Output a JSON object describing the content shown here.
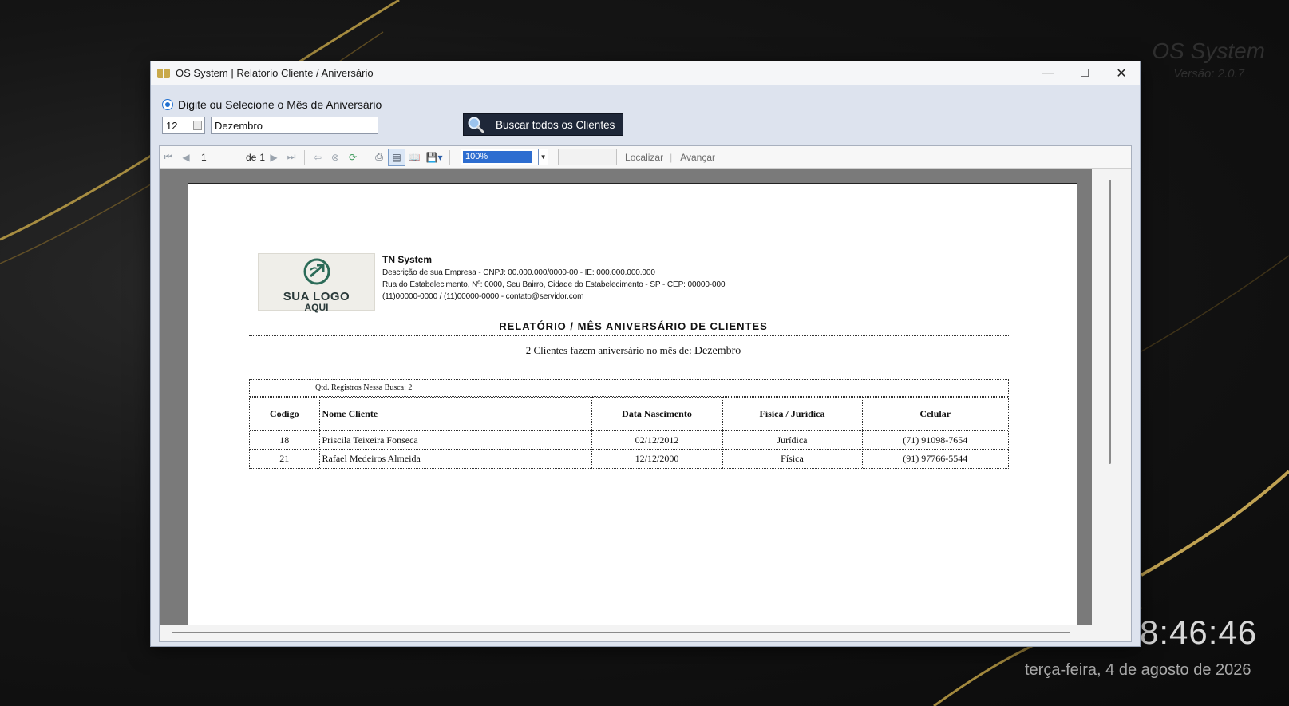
{
  "desktop": {
    "brand_name": "OS System",
    "brand_version": "Versão: 2.0.7",
    "clock_time": "8:46:46",
    "clock_date": "terça-feira, 4 de agosto de 2026"
  },
  "window": {
    "title": "OS System | Relatorio Cliente / Aniversário"
  },
  "filter": {
    "radio_label": "Digite ou Selecione o Mês de Aniversário",
    "month_number": "12",
    "month_name": "Dezembro",
    "search_all_label": "Buscar todos os Clientes"
  },
  "toolbar": {
    "current_page": "1",
    "page_of_label": "de",
    "total_pages": "1",
    "zoom": "100%",
    "find_label": "Localizar",
    "next_label": "Avançar"
  },
  "report": {
    "company_name": "TN System",
    "company_line1": "Descrição de sua Empresa  - CNPJ: 00.000.000/0000-00 -  IE: 000.000.000.000",
    "company_line2": "Rua do Estabelecimento,  Nº: 0000,  Seu Bairro,  Cidade do Estabelecimento -  SP  -  CEP: 00000-000",
    "company_line3": "(11)00000-0000 /  (11)00000-0000 -  contato@servidor.com",
    "logo_line1": "SUA LOGO",
    "logo_line2": "AQUI",
    "title": "RELATÓRIO / MÊS ANIVERSÁRIO DE CLIENTES",
    "subtitle_prefix": "2 Clientes fazem aniversário no mês de: ",
    "subtitle_month": "Dezembro",
    "records_label": "Qtd. Registros Nessa Busca: 2",
    "columns": [
      "Código",
      "Nome Cliente",
      "Data Nascimento",
      "Física / Jurídica",
      "Celular"
    ],
    "rows": [
      {
        "codigo": "18",
        "nome": "Priscila Teixeira Fonseca",
        "nascimento": "02/12/2012",
        "tipo": "Jurídica",
        "celular": "(71) 91098-7654"
      },
      {
        "codigo": "21",
        "nome": "Rafael Medeiros Almeida",
        "nascimento": "12/12/2000",
        "tipo": "Física",
        "celular": "(91) 97766-5544"
      }
    ]
  },
  "colors": {
    "accent": "#1f6fd0",
    "button_dark": "#1e2738",
    "gold": "#c9a94a"
  }
}
